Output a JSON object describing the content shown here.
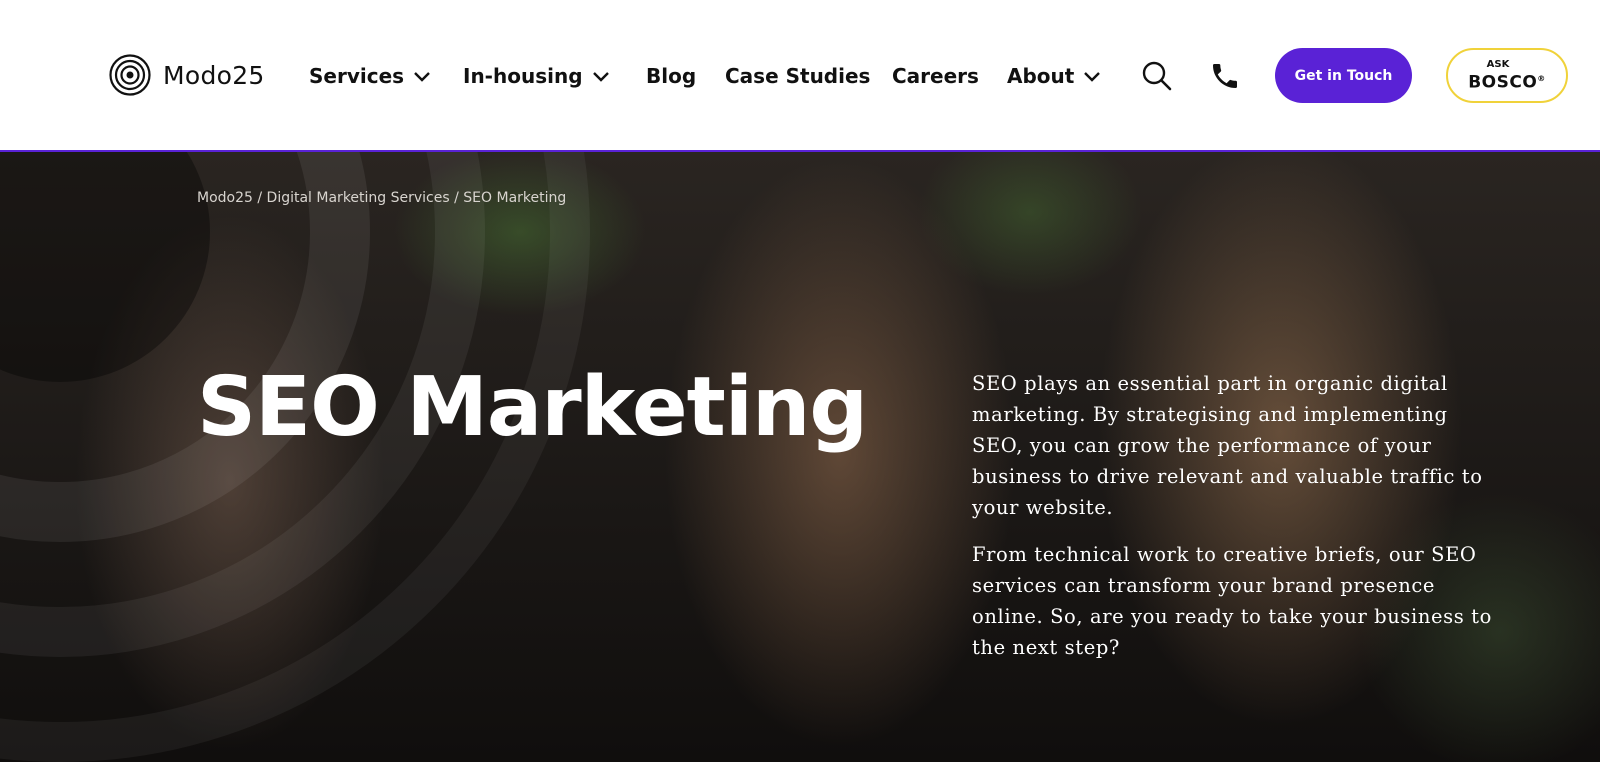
{
  "brand": {
    "name": "Modo25",
    "accent": "#5a22d6",
    "bosco_border": "#f0d23a"
  },
  "nav": {
    "items": [
      {
        "label": "Services",
        "dropdown": true
      },
      {
        "label": "In-housing",
        "dropdown": true
      },
      {
        "label": "Blog",
        "dropdown": false
      },
      {
        "label": "Case Studies",
        "dropdown": false
      },
      {
        "label": "Careers",
        "dropdown": false
      },
      {
        "label": "About",
        "dropdown": true
      }
    ],
    "search_icon": "search-icon",
    "phone_icon": "phone-icon",
    "cta_label": "Get in Touch",
    "bosco": {
      "ask": "ASK",
      "name": "BOSCO",
      "mark": "®"
    }
  },
  "hero": {
    "breadcrumb": [
      "Modo25",
      "Digital Marketing Services",
      "SEO Marketing"
    ],
    "breadcrumb_separator": " / ",
    "title": "SEO Marketing",
    "paragraphs": [
      "SEO plays an essential part in organic digital marketing. By strategising and implementing SEO, you can grow the performance of your business to drive relevant and valuable traffic to your website.",
      "From technical work to creative briefs, our SEO services can transform your brand presence online. So, are you ready to take your business to the next step?"
    ]
  }
}
